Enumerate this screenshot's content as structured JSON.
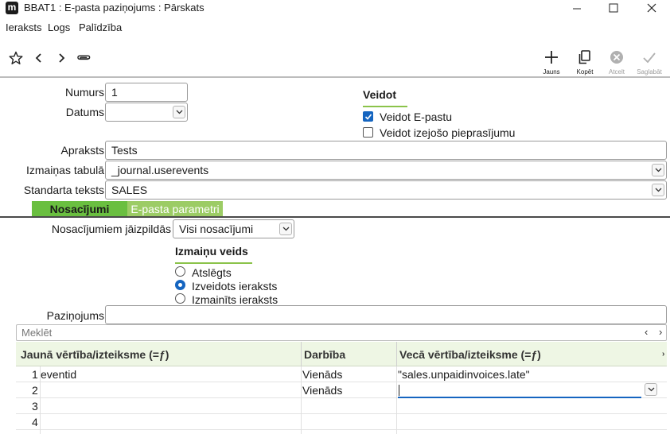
{
  "window": {
    "logo": "m",
    "title": "BBAT1 : E-pasta paziņojums : Pārskats"
  },
  "menu": [
    "Ieraksts",
    "Logs",
    "Palīdzība"
  ],
  "toolbar": {
    "buttons": [
      {
        "icon": "plus-icon",
        "label": "Jauns",
        "enabled": true
      },
      {
        "icon": "copy-icon",
        "label": "Kopēt",
        "enabled": true
      },
      {
        "icon": "cancel-icon",
        "label": "Atcelt",
        "enabled": false
      },
      {
        "icon": "checkmark-icon",
        "label": "Saglabāt",
        "enabled": false
      }
    ]
  },
  "form": {
    "numurs_label": "Numurs",
    "numurs_value": "1",
    "datums_label": "Datums",
    "datums_value": "",
    "apraksts_label": "Apraksts",
    "apraksts_value": "Tests",
    "tabula_label": "Izmaiņas tabulā",
    "tabula_value": "_journal.userevents",
    "teksts_label": "Standarta teksts",
    "teksts_value": "SALES"
  },
  "veidot": {
    "heading": "Veidot",
    "options": [
      {
        "label": "Veidot E-pastu",
        "checked": true
      },
      {
        "label": "Veidot izejošo pieprasījumu",
        "checked": false
      }
    ]
  },
  "tabs": [
    {
      "label": "Nosacījumi",
      "active": true
    },
    {
      "label": "E-pasta parametri",
      "active": false
    }
  ],
  "conditions": {
    "fill_label": "Nosacījumiem jāizpildās",
    "fill_value": "Visi nosacījumi",
    "change_heading": "Izmaiņu veids",
    "change_options": [
      {
        "label": "Atslēgts",
        "selected": false
      },
      {
        "label": "Izveidots ieraksts",
        "selected": true
      },
      {
        "label": "Izmainīts ieraksts",
        "selected": false
      }
    ],
    "message_label": "Paziņojums",
    "message_value": ""
  },
  "grid": {
    "search_placeholder": "Meklēt",
    "columns": [
      "Jaunā vērtība/izteiksme (=ƒ)",
      "Darbība",
      "Vecā vērtība/izteiksme (=ƒ)"
    ],
    "rows": [
      {
        "num": "1",
        "new": "eventid",
        "action": "Vienāds",
        "old": "\"sales.unpaidinvoices.late\""
      },
      {
        "num": "2",
        "new": "",
        "action": "Vienāds",
        "old": ""
      },
      {
        "num": "3",
        "new": "",
        "action": "",
        "old": ""
      },
      {
        "num": "4",
        "new": "",
        "action": "",
        "old": ""
      }
    ]
  },
  "colors": {
    "accent_green": "#6abf40",
    "light_green": "#9ccc65",
    "check_blue": "#1565c0"
  }
}
